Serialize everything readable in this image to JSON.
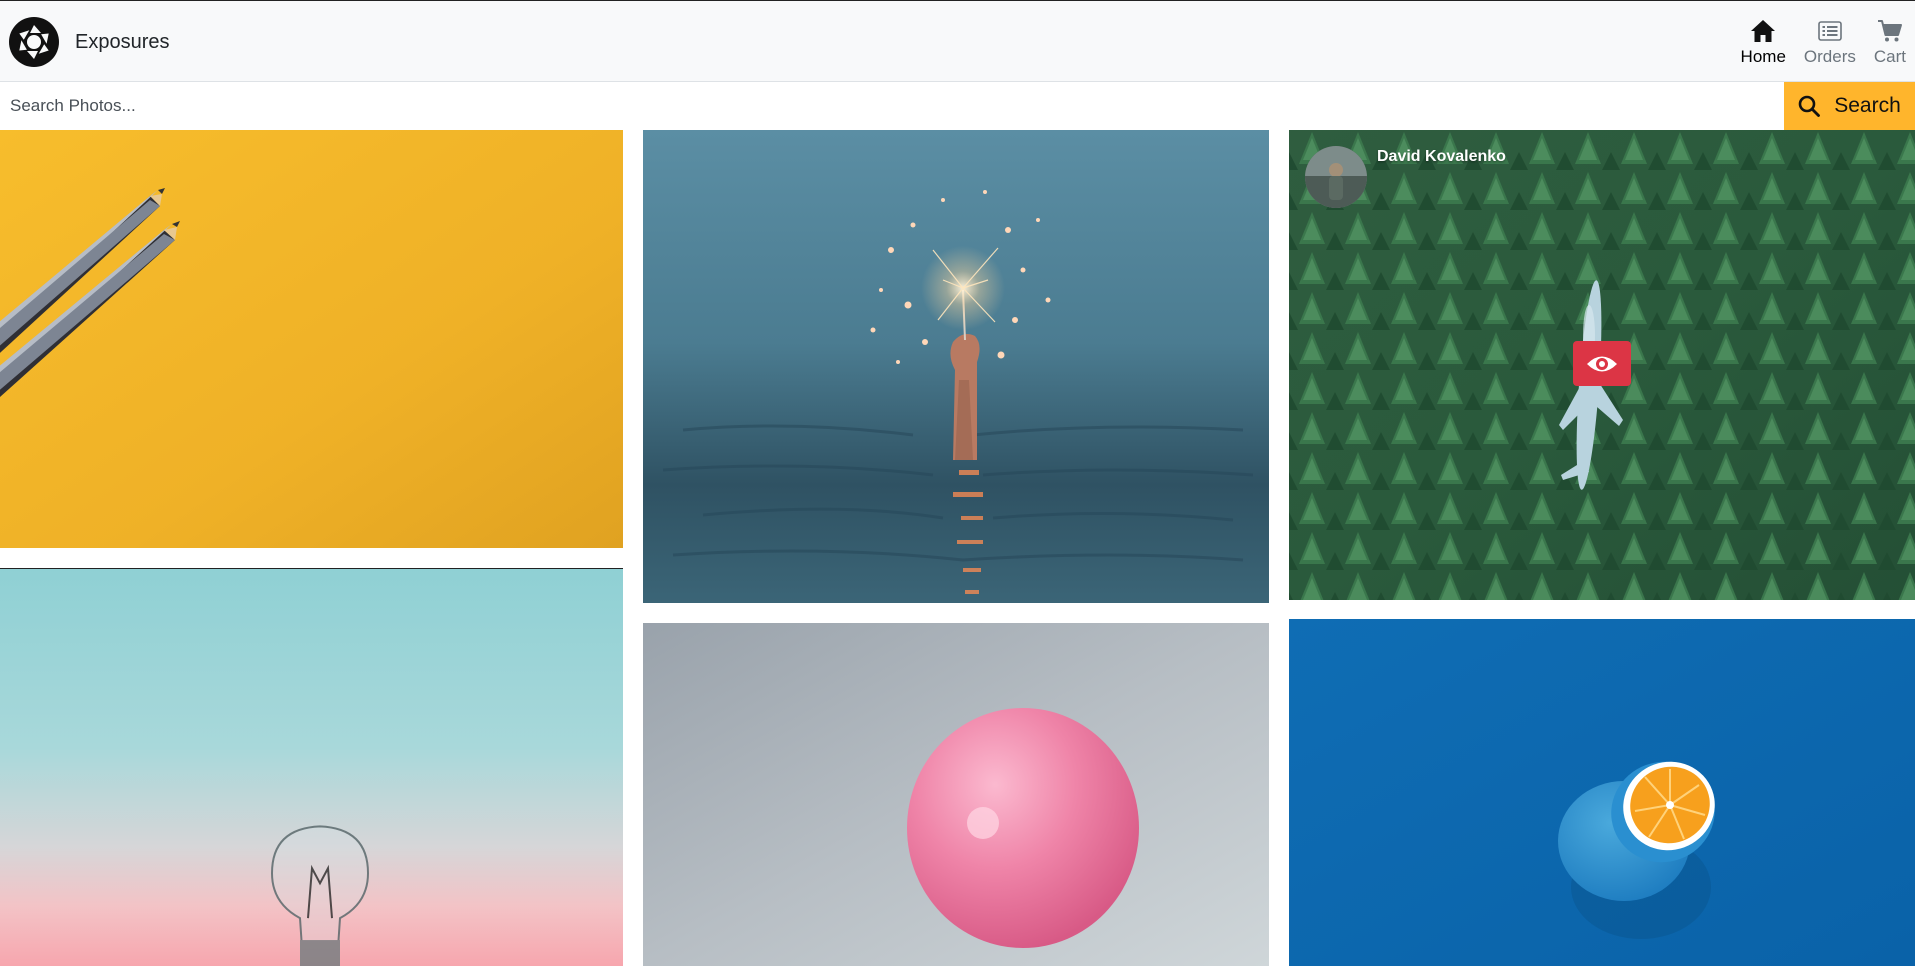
{
  "app": {
    "brand_name": "Exposures"
  },
  "nav": {
    "items": [
      {
        "label": "Home",
        "icon": "home-icon",
        "active": true
      },
      {
        "label": "Orders",
        "icon": "list-icon",
        "active": false
      },
      {
        "label": "Cart",
        "icon": "cart-icon",
        "active": false
      }
    ]
  },
  "search": {
    "placeholder": "Search Photos...",
    "value": "",
    "button_label": "Search",
    "icon": "search-icon"
  },
  "gallery": {
    "photos": [
      {
        "subject": "two pencils on yellow background"
      },
      {
        "subject": "hand holding sparkler above water"
      },
      {
        "subject": "airplane in pine forest",
        "photographer": "David Kovalenko",
        "overlay_visible": true,
        "overlay_icon": "eye-icon"
      },
      {
        "subject": "light bulb against pastel sky"
      },
      {
        "subject": "pink balloon on grey background"
      },
      {
        "subject": "blue painted orange on blue background"
      }
    ]
  },
  "colors": {
    "accent": "#ffb52c",
    "view_button": "#dc3545",
    "navbar_bg": "#f8f9fa"
  }
}
